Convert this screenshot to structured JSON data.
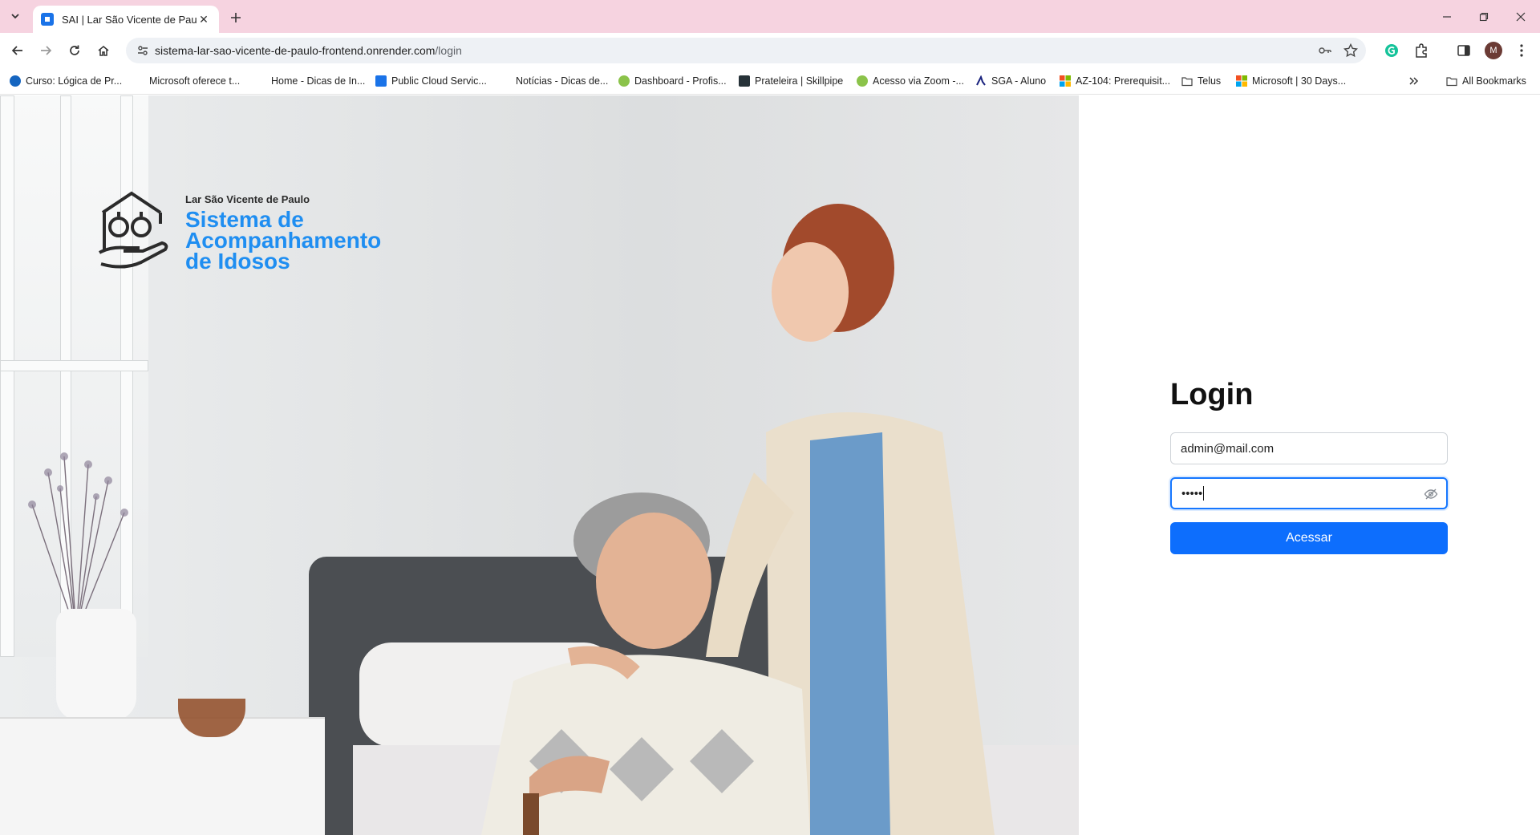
{
  "browser": {
    "tab_title": "SAI | Lar São Vicente de Paulo",
    "url_host": "sistema-lar-sao-vicente-de-paulo-frontend.onrender.com",
    "url_path": "/login",
    "avatar_initial": "M",
    "bookmarks": [
      {
        "label": "Curso: Lógica de Pr...",
        "icon": "blue-cloud-icon",
        "color": "#1565c0"
      },
      {
        "label": "Microsoft oferece t...",
        "icon": "page-icon",
        "color": "#ffffff"
      },
      {
        "label": "Home - Dicas de In...",
        "icon": "page-icon",
        "color": "#ffffff"
      },
      {
        "label": "Public Cloud Servic...",
        "icon": "cloud-icon",
        "color": "#1a73e8"
      },
      {
        "label": "Notícias - Dicas de...",
        "icon": "page-icon",
        "color": "#ffffff"
      },
      {
        "label": "Dashboard - Profis...",
        "icon": "green-leaf-icon",
        "color": "#8bc34a"
      },
      {
        "label": "Prateleira | Skillpipe",
        "icon": "book-icon",
        "color": "#263238"
      },
      {
        "label": "Acesso via Zoom -...",
        "icon": "green-leaf-icon",
        "color": "#8bc34a"
      },
      {
        "label": "SGA - Aluno",
        "icon": "arrow-icon",
        "color": "#1a237e"
      },
      {
        "label": "AZ-104: Prerequisit...",
        "icon": "microsoft-icon",
        "color": "#f25022"
      },
      {
        "label": "Telus",
        "icon": "folder-icon",
        "color": "#ffffff"
      },
      {
        "label": "Microsoft | 30 Days...",
        "icon": "microsoft-icon",
        "color": "#f25022"
      }
    ],
    "all_bookmarks_label": "All Bookmarks"
  },
  "logo": {
    "org": "Lar São Vicente de Paulo",
    "line1": "Sistema de",
    "line2": "Acompanhamento",
    "line3": "de Idosos"
  },
  "login": {
    "title": "Login",
    "email_value": "admin@mail.com",
    "password_mask": "•••••",
    "submit_label": "Acessar"
  },
  "colors": {
    "tabstrip": "#f6d3e0",
    "brand_blue": "#1f8ef1",
    "button_blue": "#0d6efd"
  }
}
